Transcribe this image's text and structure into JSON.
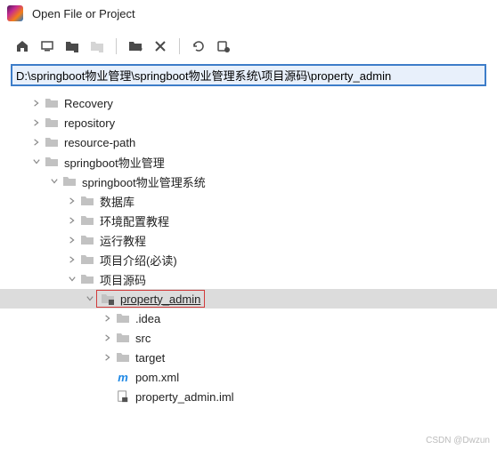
{
  "title": "Open File or Project",
  "path": "D:\\springboot物业管理\\springboot物业管理系统\\项目源码\\property_admin",
  "tree": {
    "recovery": "Recovery",
    "repository": "repository",
    "resourcepath": "resource-path",
    "sb1": "springboot物业管理",
    "sb2": "springboot物业管理系统",
    "db": "数据库",
    "envtut": "环境配置教程",
    "runtut": "运行教程",
    "intro": "项目介绍(必读)",
    "src": "项目源码",
    "propadmin": "property_admin",
    "idea": ".idea",
    "srcfolder": "src",
    "target": "target",
    "pom": "pom.xml",
    "iml": "property_admin.iml"
  },
  "watermark": "CSDN @Dwzun"
}
